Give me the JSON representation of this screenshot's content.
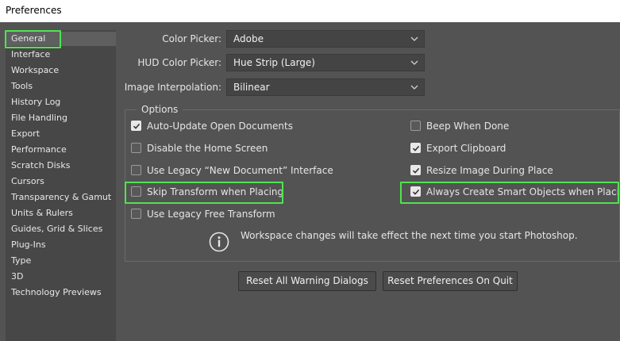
{
  "window": {
    "title": "Preferences"
  },
  "sidebar": {
    "items": [
      {
        "label": "General",
        "selected": true
      },
      {
        "label": "Interface"
      },
      {
        "label": "Workspace"
      },
      {
        "label": "Tools"
      },
      {
        "label": "History Log"
      },
      {
        "label": "File Handling"
      },
      {
        "label": "Export"
      },
      {
        "label": "Performance"
      },
      {
        "label": "Scratch Disks"
      },
      {
        "label": "Cursors"
      },
      {
        "label": "Transparency & Gamut"
      },
      {
        "label": "Units & Rulers"
      },
      {
        "label": "Guides, Grid & Slices"
      },
      {
        "label": "Plug-Ins"
      },
      {
        "label": "Type"
      },
      {
        "label": "3D"
      },
      {
        "label": "Technology Previews"
      }
    ]
  },
  "fields": {
    "color_picker": {
      "label": "Color Picker:",
      "value": "Adobe"
    },
    "hud_color_picker": {
      "label": "HUD Color Picker:",
      "value": "Hue Strip (Large)"
    },
    "image_interpolation": {
      "label": "Image Interpolation:",
      "value": "Bilinear"
    }
  },
  "options": {
    "legend": "Options",
    "left": [
      {
        "label": "Auto-Update Open Documents",
        "checked": true
      },
      {
        "label": "Disable the Home Screen",
        "checked": false
      },
      {
        "label": "Use Legacy “New Document” Interface",
        "checked": false
      },
      {
        "label": "Skip Transform when Placing",
        "checked": false
      },
      {
        "label": "Use Legacy Free Transform",
        "checked": false
      }
    ],
    "right": [
      {
        "label": "Beep When Done",
        "checked": false
      },
      {
        "label": "Export Clipboard",
        "checked": true
      },
      {
        "label": "Resize Image During Place",
        "checked": true
      },
      {
        "label": "Always Create Smart Objects when Placing",
        "checked": true
      }
    ],
    "info_text": "Workspace changes will take effect the next time you start Photoshop."
  },
  "buttons": {
    "reset_warnings": "Reset All Warning Dialogs",
    "reset_on_quit": "Reset Preferences On Quit"
  },
  "colors": {
    "highlight": "#4fe34f",
    "background": "#535353",
    "sidebar": "#474747"
  }
}
